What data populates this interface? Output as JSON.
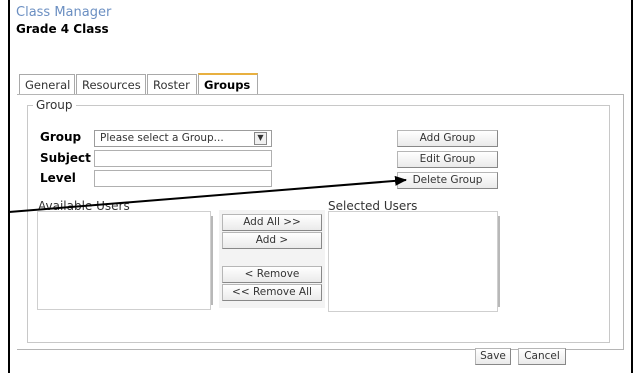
{
  "app": {
    "title": "Class Manager",
    "class_name": "Grade 4 Class"
  },
  "tabs": [
    {
      "label": "General",
      "active": false
    },
    {
      "label": "Resources",
      "active": false
    },
    {
      "label": "Roster",
      "active": false
    },
    {
      "label": "Groups",
      "active": true
    }
  ],
  "group_section": {
    "legend": "Group",
    "group_label": "Group",
    "group_select_value": "Please select a Group...",
    "subject_label": "Subject",
    "subject_value": "",
    "level_label": "Level",
    "level_value": "",
    "add_group": "Add Group",
    "edit_group": "Edit Group",
    "delete_group": "Delete Group"
  },
  "users": {
    "available_label": "Available Users",
    "selected_label": "Selected Users",
    "available": [],
    "selected": [],
    "add_all": "Add All >>",
    "add": "Add >",
    "remove": "< Remove",
    "remove_all": "<< Remove All"
  },
  "footer": {
    "save": "Save",
    "cancel": "Cancel"
  },
  "colors": {
    "title": "#6b8fc2",
    "active_tab_accent": "#e8b040"
  }
}
